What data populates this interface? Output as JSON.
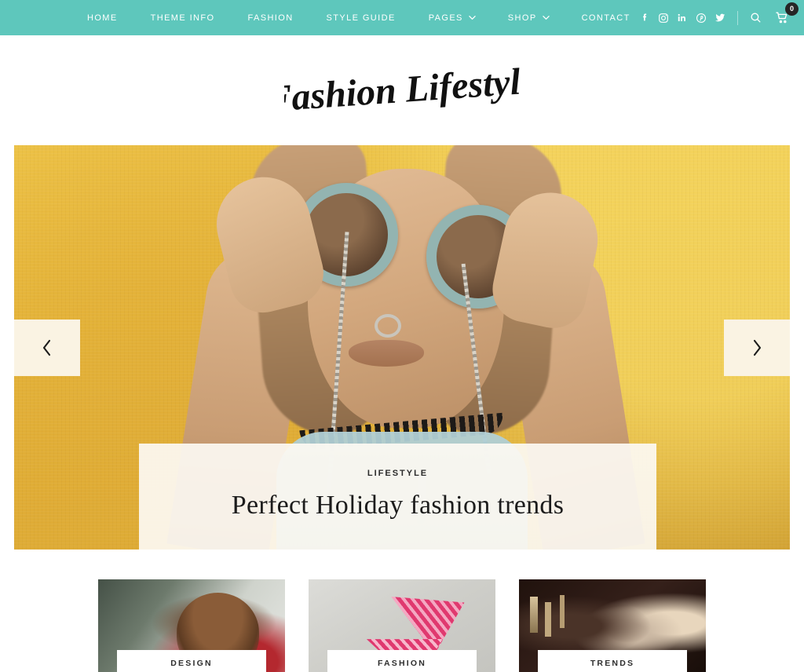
{
  "site": {
    "logo_text": "Fashion Lifestyle",
    "accent_color": "#5ec7bc",
    "caption_bg": "#fcf9f2"
  },
  "navbar": {
    "menu": [
      {
        "label": "HOME",
        "has_dropdown": false
      },
      {
        "label": "THEME INFO",
        "has_dropdown": false
      },
      {
        "label": "FASHION",
        "has_dropdown": false
      },
      {
        "label": "STYLE GUIDE",
        "has_dropdown": false
      },
      {
        "label": "PAGES",
        "has_dropdown": true
      },
      {
        "label": "SHOP",
        "has_dropdown": true
      },
      {
        "label": "CONTACT",
        "has_dropdown": false
      }
    ],
    "social": [
      {
        "name": "facebook-icon",
        "title": "Facebook"
      },
      {
        "name": "instagram-icon",
        "title": "Instagram"
      },
      {
        "name": "linkedin-icon",
        "title": "LinkedIn"
      },
      {
        "name": "pinterest-icon",
        "title": "Pinterest"
      },
      {
        "name": "twitter-icon",
        "title": "Twitter"
      }
    ],
    "search_label": "Search",
    "cart_label": "Cart",
    "cart_count": "0"
  },
  "hero": {
    "prev_label": "‹",
    "next_label": "›",
    "slide": {
      "category": "LIFESTYLE",
      "title": "Perfect Holiday fashion trends",
      "image_alt": "Woman in large round sunglasses against a yellow wall"
    }
  },
  "cards": [
    {
      "label": "DESIGN",
      "image_alt": "Woman with curly hair in a snowy forest wearing red"
    },
    {
      "label": "FASHION",
      "image_alt": "Pink striped bikini laid on a grey textured surface"
    },
    {
      "label": "TRENDS",
      "image_alt": "Three glamorous women holding champagne glasses in a dark bar"
    }
  ]
}
